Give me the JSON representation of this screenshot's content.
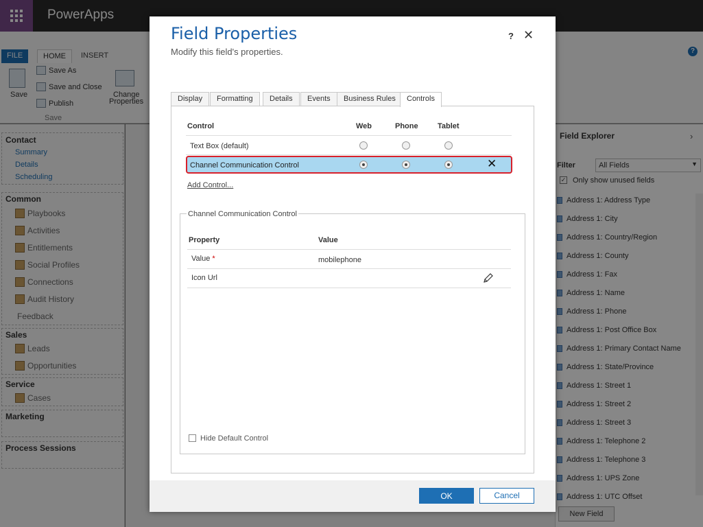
{
  "app": {
    "title": "PowerApps"
  },
  "ribbon": {
    "tabs": [
      "FILE",
      "HOME",
      "INSERT"
    ],
    "save": "Save",
    "save_as": "Save As",
    "save_and_close": "Save and Close",
    "publish": "Publish",
    "group_save": "Save",
    "change_properties_1": "Change",
    "change_properties_2": "Properties",
    "help": "?"
  },
  "nav": {
    "contact": "Contact",
    "contact_items": [
      "Summary",
      "Details",
      "Scheduling"
    ],
    "common": "Common",
    "common_items": [
      "Playbooks",
      "Activities",
      "Entitlements",
      "Social Profiles",
      "Connections",
      "Audit History",
      "Feedback"
    ],
    "sales": "Sales",
    "sales_items": [
      "Leads",
      "Opportunities"
    ],
    "service": "Service",
    "service_items": [
      "Cases"
    ],
    "marketing": "Marketing",
    "process": "Process Sessions"
  },
  "field_explorer": {
    "title": "Field Explorer",
    "filter_label": "Filter",
    "filter_value": "All Fields",
    "unused_label": "Only show unused fields",
    "fields": [
      "Address 1: Address Type",
      "Address 1: City",
      "Address 1: Country/Region",
      "Address 1: County",
      "Address 1: Fax",
      "Address 1: Name",
      "Address 1: Phone",
      "Address 1: Post Office Box",
      "Address 1: Primary Contact Name",
      "Address 1: State/Province",
      "Address 1: Street 1",
      "Address 1: Street 2",
      "Address 1: Street 3",
      "Address 1: Telephone 2",
      "Address 1: Telephone 3",
      "Address 1: UPS Zone",
      "Address 1: UTC Offset"
    ],
    "new_field": "New Field"
  },
  "dialog": {
    "title": "Field Properties",
    "subtitle": "Modify this field's properties.",
    "help": "?",
    "close": "✕",
    "tabs": [
      "Display",
      "Formatting",
      "Details",
      "Events",
      "Business Rules",
      "Controls"
    ],
    "active_tab": "Controls",
    "controls_table": {
      "headers": {
        "control": "Control",
        "web": "Web",
        "phone": "Phone",
        "tablet": "Tablet"
      },
      "rows": [
        {
          "name": "Text Box (default)",
          "web": false,
          "phone": false,
          "tablet": false
        },
        {
          "name": "Channel Communication Control",
          "web": true,
          "phone": true,
          "tablet": true
        }
      ],
      "delete_glyph": "✕",
      "add_control": "Add Control..."
    },
    "properties": {
      "legend": "Channel Communication Control",
      "headers": {
        "property": "Property",
        "value": "Value"
      },
      "rows": [
        {
          "property": "Value",
          "required": "*",
          "value": "mobilephone"
        },
        {
          "property": "Icon Url",
          "value": ""
        }
      ]
    },
    "hide_default": "Hide Default Control",
    "ok": "OK",
    "cancel": "Cancel"
  }
}
